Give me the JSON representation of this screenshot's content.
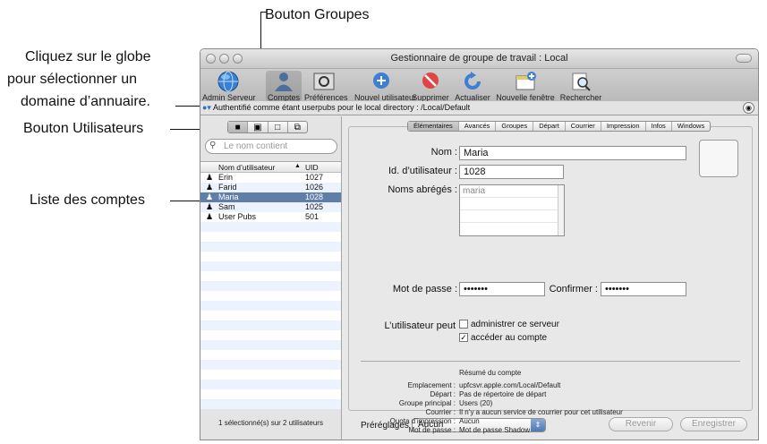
{
  "callouts": {
    "groups_button": "Bouton Groupes",
    "globe_1": "Cliquez sur le globe",
    "globe_2": "pour sélectionner un",
    "globe_3": "domaine d’annuaire.",
    "users_button": "Bouton Utilisateurs",
    "accounts_list": "Liste des comptes"
  },
  "window": {
    "title": "Gestionnaire de groupe de travail : Local"
  },
  "toolbar": {
    "items": [
      {
        "label": "Admin Serveur",
        "icon": "globe-icon"
      },
      {
        "label": "Comptes",
        "icon": "accounts-icon"
      },
      {
        "label": "Préférences",
        "icon": "preferences-icon"
      },
      {
        "label": "Nouvel utilisateur",
        "icon": "add-icon"
      },
      {
        "label": "Supprimer",
        "icon": "delete-icon"
      },
      {
        "label": "Actualiser",
        "icon": "refresh-icon"
      },
      {
        "label": "Nouvelle fenêtre",
        "icon": "new-window-icon"
      },
      {
        "label": "Rechercher",
        "icon": "search-icon"
      }
    ]
  },
  "authbar": {
    "text": "Authentifié comme étant userpubs pour le local directory : /Local/Default"
  },
  "left": {
    "search_placeholder": "Le nom contient",
    "col_name": "Nom d’utilisateur",
    "col_uid": "UID",
    "users": [
      {
        "name": "Erin",
        "uid": "1027"
      },
      {
        "name": "Farid",
        "uid": "1026"
      },
      {
        "name": "Maria",
        "uid": "1028"
      },
      {
        "name": "Sam",
        "uid": "1025"
      },
      {
        "name": "User Pubs",
        "uid": "501"
      }
    ],
    "status": "1 sélectionné(s) sur 2 utilisateurs"
  },
  "tabs": [
    "Élémentaires",
    "Avancés",
    "Groupes",
    "Départ",
    "Courrier",
    "Impression",
    "Infos",
    "Windows"
  ],
  "form": {
    "name_label": "Nom :",
    "name_value": "Maria",
    "uid_label": "Id. d’utilisateur :",
    "uid_value": "1028",
    "short_label": "Noms abrégés :",
    "short_value": "maria",
    "pw_label": "Mot de passe :",
    "pw_value": "•••••••",
    "confirm_label": "Confirmer :",
    "confirm_value": "•••••••",
    "can_label": "L’utilisateur peut",
    "admin_label": "administrer ce serveur",
    "access_label": "accéder au compte"
  },
  "summary": {
    "title": "Résumé du compte",
    "rows": [
      {
        "k": "Emplacement :",
        "v": "upfcsvr.apple.com/Local/Default"
      },
      {
        "k": "Départ :",
        "v": "Pas de répertoire de départ"
      },
      {
        "k": "Groupe principal :",
        "v": "Users (20)"
      },
      {
        "k": "Courrier :",
        "v": "Il n’y a aucun service de courrier pour cet utilisateur"
      },
      {
        "k": "Quota d’impression :",
        "v": "Aucun"
      },
      {
        "k": "Mot de passe :",
        "v": "Mot de passe Shadow"
      }
    ]
  },
  "bottom": {
    "presets_label": "Préréglages :",
    "presets_value": "Aucun",
    "revert": "Revenir",
    "save": "Enregistrer"
  }
}
